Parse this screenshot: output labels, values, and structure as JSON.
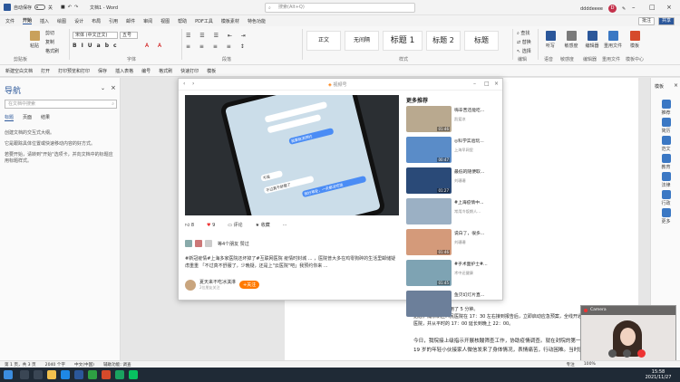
{
  "titlebar": {
    "autosave_label": "自动保存",
    "autosave_state": "关",
    "doc_name": "文档1 - Word",
    "search_placeholder": "搜索(Alt+Q)",
    "user_name": "ddddeeee",
    "user_initial": "D"
  },
  "ribbon_tabs": [
    "文件",
    "开始",
    "插入",
    "绘图",
    "设计",
    "布局",
    "引用",
    "邮件",
    "审阅",
    "视图",
    "帮助",
    "PDF工具",
    "模板素材",
    "特色功能"
  ],
  "ribbon_active": "开始",
  "ribbon_right": {
    "comment": "批注",
    "share": "共享"
  },
  "ribbon": {
    "font_name": "宋体 (中文正文)",
    "font_size": "五号",
    "groups": [
      "剪贴板",
      "字体",
      "段落",
      "样式",
      "编辑",
      "语音",
      "敏感度",
      "编辑器",
      "重用文件",
      "模板中心"
    ],
    "paste": "粘贴",
    "cut": "剪切",
    "copy": "复制",
    "painter": "格式刷",
    "styles": [
      "正文",
      "无间隔",
      "标题 1",
      "标题 2",
      "标题"
    ],
    "edit_items": [
      "查找",
      "替换",
      "选择"
    ],
    "big_buttons": [
      "听写",
      "敏感度",
      "编辑器",
      "重用文件",
      "模板"
    ]
  },
  "toolbar2": [
    "新建空白文档",
    "打开",
    "打印预览和打印",
    "保存",
    "插入表格",
    "编号",
    "格式刷",
    "快速打印",
    "模板"
  ],
  "nav": {
    "title": "导航",
    "search_placeholder": "在文档中搜索",
    "tabs": [
      "标题",
      "页面",
      "结果"
    ],
    "texts": [
      "创建文档的交互式大纲。",
      "它是跟踪具体位置或快速移动内容的好方式。",
      "若要开始，请转到\"开始\"选项卡，并向文档中的标题应用标题样式。"
    ]
  },
  "doc": {
    "lines": [
      "生成结果，全程只用了 5 分钟。",
      "据悉，浦东新区人民医院在 17：30 左右接到报告后，立即启动应急预案，全线开通互联网",
      "医院，并从平时的 17：00 延长到晚上 22：00。",
      "今日，我院接上级指示开展核酸筛查工作，协助疫情调查。就在封院的第一时间，一名",
      "19 岁的年轻小伙接家人微信发来了身体情况，表情痛苦，行动困难。当时医"
    ]
  },
  "right_pane": {
    "title": "模板",
    "items": [
      "推荐",
      "简历",
      "范文",
      "教育",
      "法律",
      "行政",
      "更多"
    ]
  },
  "popup": {
    "app_title": "视频号",
    "video_texts": [
      "我要取消预约",
      "不是",
      "不过真不舒服了",
      "我好难受，一天都没吃饭"
    ],
    "likes": "8",
    "hearts": "9",
    "comments": "评论",
    "favorite": "收藏",
    "more": "···",
    "liked_by": "等4个朋友 赞过",
    "caption": "#新冠疫情#上海多家医院还坏掉了#互联网医院 疫情时封城 ... ，医院普大多在鸡零狗碎的生活里邮储疑虑重重 「不过真不舒服了，少晚疑，还是上\"云医院\"吧」我预约你来 ...",
    "author": "夏天来不吃冰淇淋",
    "author_sub": "2位朋友关注",
    "follow": "+关注",
    "more_header": "更多推荐",
    "recs": [
      {
        "title": "嗨辛苦还能吃...",
        "author": "凯爱凉",
        "dur": "01:46"
      },
      {
        "title": "◎科学实验玩...",
        "author": "上海早网里",
        "dur": "00:47"
      },
      {
        "title": "最低的随便取...",
        "author": "刘珊珊",
        "dur": "01:27"
      },
      {
        "title": "#上海疫情中...",
        "author": "常用冷饭期人...",
        "dur": ""
      },
      {
        "title": "说白了，很多...",
        "author": "刘珊珊",
        "dur": "01:46"
      },
      {
        "title": "#乎术面护士#...",
        "author": "术中还健康",
        "dur": "01:45"
      },
      {
        "title": "鱼贝幻灯片直...",
        "author": "",
        "dur": ""
      }
    ]
  },
  "status": {
    "page": "第 1 页，共 3 页",
    "words": "2040 个字",
    "lang": "中文(中国)",
    "access": "辅助功能: 调查",
    "focus": "专注",
    "zoom": "100%"
  },
  "taskbar": {
    "time": "15:58",
    "date": "2021/11/27"
  },
  "webcam": {
    "label": "Camera"
  },
  "colors": {
    "word_blue": "#2b579a",
    "orange": "#ff7a00",
    "taskbar": "#1f2a36"
  }
}
